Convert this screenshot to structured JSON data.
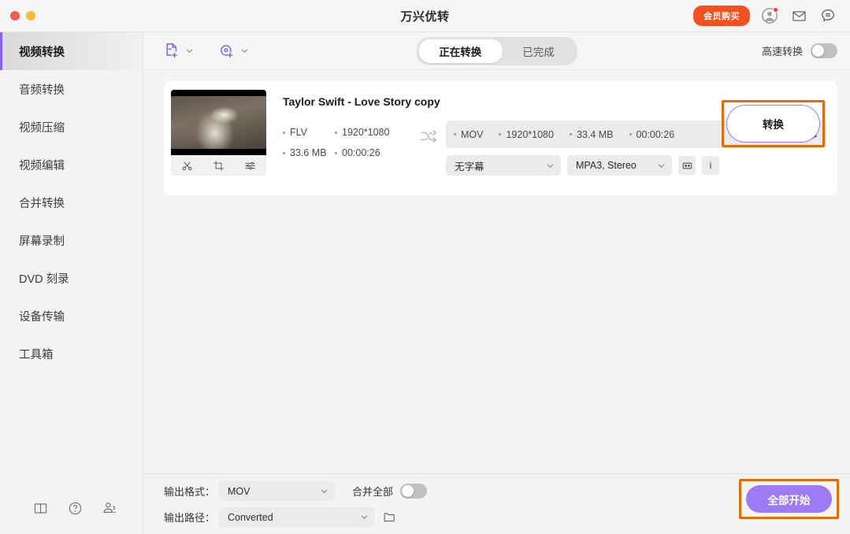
{
  "window": {
    "title": "万兴优转",
    "controls": [
      "close",
      "minimize"
    ]
  },
  "titlebar": {
    "vip_button": "会员购买",
    "icons": [
      "avatar-icon",
      "mail-icon",
      "feedback-icon"
    ]
  },
  "sidebar": {
    "items": [
      {
        "label": "视频转换",
        "active": true
      },
      {
        "label": "音频转换",
        "active": false
      },
      {
        "label": "视频压缩",
        "active": false
      },
      {
        "label": "视频编辑",
        "active": false
      },
      {
        "label": "合并转换",
        "active": false
      },
      {
        "label": "屏幕录制",
        "active": false
      },
      {
        "label": "DVD 刻录",
        "active": false
      },
      {
        "label": "设备传输",
        "active": false
      },
      {
        "label": "工具箱",
        "active": false
      }
    ],
    "bottom_icons": [
      "book-icon",
      "help-icon",
      "community-icon"
    ]
  },
  "toolbar": {
    "add_file_icon": "add-file-icon",
    "add_disc_icon": "add-disc-icon",
    "tabs": [
      {
        "label": "正在转换",
        "active": true
      },
      {
        "label": "已完成",
        "active": false
      }
    ],
    "high_speed_label": "高速转换",
    "high_speed_enabled": false
  },
  "file_card": {
    "name": "Taylor Swift - Love Story copy",
    "thumb_tools": [
      "trim-icon",
      "crop-icon",
      "effects-icon"
    ],
    "source": {
      "format": "FLV",
      "resolution": "1920*1080",
      "size": "33.6 MB",
      "duration": "00:00:26"
    },
    "convert_arrow_icon": "shuffle-icon",
    "target": {
      "format": "MOV",
      "resolution": "1920*1080",
      "size": "33.4 MB",
      "duration": "00:00:26",
      "settings_icon": "gear-icon"
    },
    "subtitle_select": "无字幕",
    "audio_select": "MPA3, Stereo",
    "compress_icon": "compress-icon",
    "info_icon": "i",
    "convert_button": "转换"
  },
  "footer": {
    "output_format_label": "输出格式：",
    "output_format_value": "MOV",
    "merge_all_label": "合并全部",
    "merge_all_enabled": false,
    "output_path_label": "输出路径：",
    "output_path_value": "Converted",
    "folder_icon": "folder-icon",
    "start_all_button": "全部开始"
  },
  "colors": {
    "accent_purple": "#9d7bf5",
    "vip_orange": "#f4511e",
    "highlight_orange": "#e06c0a"
  }
}
